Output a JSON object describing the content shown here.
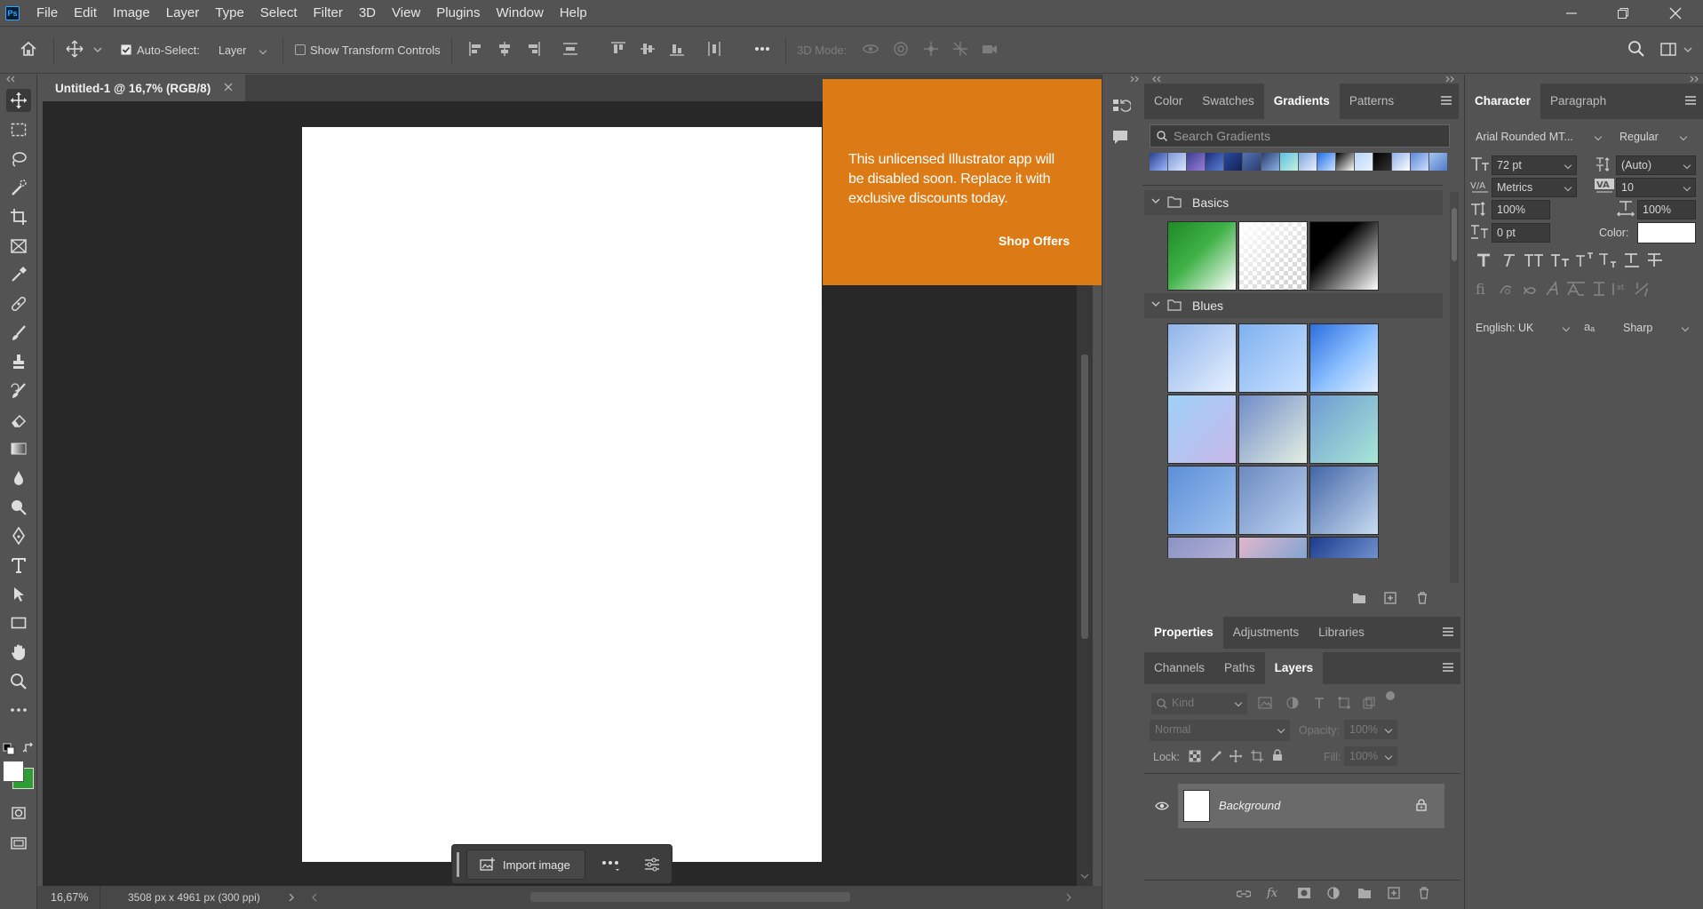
{
  "app": {
    "logo_text": "Ps"
  },
  "menu": [
    "File",
    "Edit",
    "Image",
    "Layer",
    "Type",
    "Select",
    "Filter",
    "3D",
    "View",
    "Plugins",
    "Window",
    "Help"
  ],
  "options": {
    "auto_select_label": "Auto-Select:",
    "auto_select_checked": true,
    "auto_select_value": "Layer",
    "transform_controls_label": "Show Transform Controls",
    "mode_3d_label": "3D Mode:"
  },
  "document": {
    "tab_title": "Untitled-1 @ 16,7% (RGB/8)",
    "zoom": "16,67%",
    "doc_info": "3508 px x 4961 px (300 ppi)"
  },
  "promo": {
    "message": "This unlicensed Illustrator app will be disabled soon. Replace it with exclusive discounts today.",
    "cta": "Shop Offers",
    "color": "#dc7b15"
  },
  "floating_bar": {
    "import_label": "Import image"
  },
  "gradients_panel": {
    "tabs": [
      "Color",
      "Swatches",
      "Gradients",
      "Patterns"
    ],
    "active_tab": "Gradients",
    "search_placeholder": "Search Gradients",
    "groups": [
      {
        "name": "Basics"
      },
      {
        "name": "Blues"
      }
    ]
  },
  "properties_panel": {
    "tabs": [
      "Properties",
      "Adjustments",
      "Libraries"
    ],
    "active_tab": "Properties"
  },
  "layers_panel": {
    "tabs": [
      "Channels",
      "Paths",
      "Layers"
    ],
    "active_tab": "Layers",
    "filter_kind": "Kind",
    "blend_mode": "Normal",
    "opacity_label": "Opacity:",
    "opacity_value": "100%",
    "lock_label": "Lock:",
    "fill_label": "Fill:",
    "fill_value": "100%",
    "layers": [
      {
        "name": "Background",
        "visible": true,
        "locked": true
      }
    ]
  },
  "character_panel": {
    "tabs": [
      "Character",
      "Paragraph"
    ],
    "active_tab": "Character",
    "font_family": "Arial Rounded MT...",
    "font_style": "Regular",
    "font_size": "72 pt",
    "leading": "(Auto)",
    "kerning": "Metrics",
    "tracking": "10",
    "vertical_scale": "100%",
    "horizontal_scale": "100%",
    "baseline_shift": "0 pt",
    "color_label": "Color:",
    "text_color": "#ffffff",
    "language": "English: UK",
    "antialias": "Sharp",
    "antialias_glyph": "aₐ"
  }
}
